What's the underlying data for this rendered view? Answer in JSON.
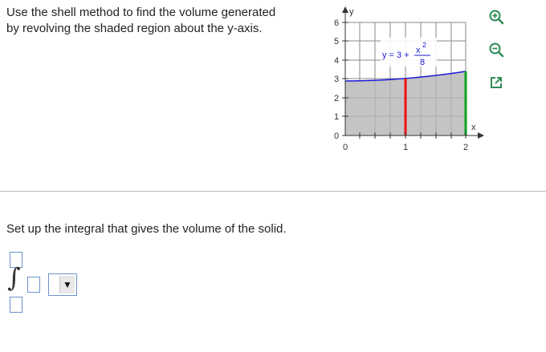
{
  "question": {
    "line1": "Use the shell method to find the volume generated",
    "line2": "by revolving the shaded region about the y-axis."
  },
  "graph": {
    "y_axis_label": "y",
    "x_axis_label": "x",
    "y_ticks": [
      "0",
      "1",
      "2",
      "3",
      "4",
      "5",
      "6"
    ],
    "x_ticks": [
      "0",
      "1",
      "2"
    ],
    "equation_prefix": "y = 3 +",
    "equation_numerator": "x",
    "equation_exponent": "2",
    "equation_denominator": "8",
    "colors": {
      "curve": "#1a1ad6",
      "region_fill": "#c4c4c4",
      "red_line": "#ee1111",
      "green_line": "#11a022",
      "grid": "#8a8a8a",
      "axis": "#333333"
    }
  },
  "tools": {
    "zoom_in": "zoom-in-icon",
    "zoom_out": "zoom-out-icon",
    "popout": "popout-icon",
    "color": "#2e8b57"
  },
  "prompt": "Set up the integral that gives the volume of the solid.",
  "integral": {
    "upper_limit": "",
    "lower_limit": "",
    "integrand": "",
    "differential": "▼"
  }
}
